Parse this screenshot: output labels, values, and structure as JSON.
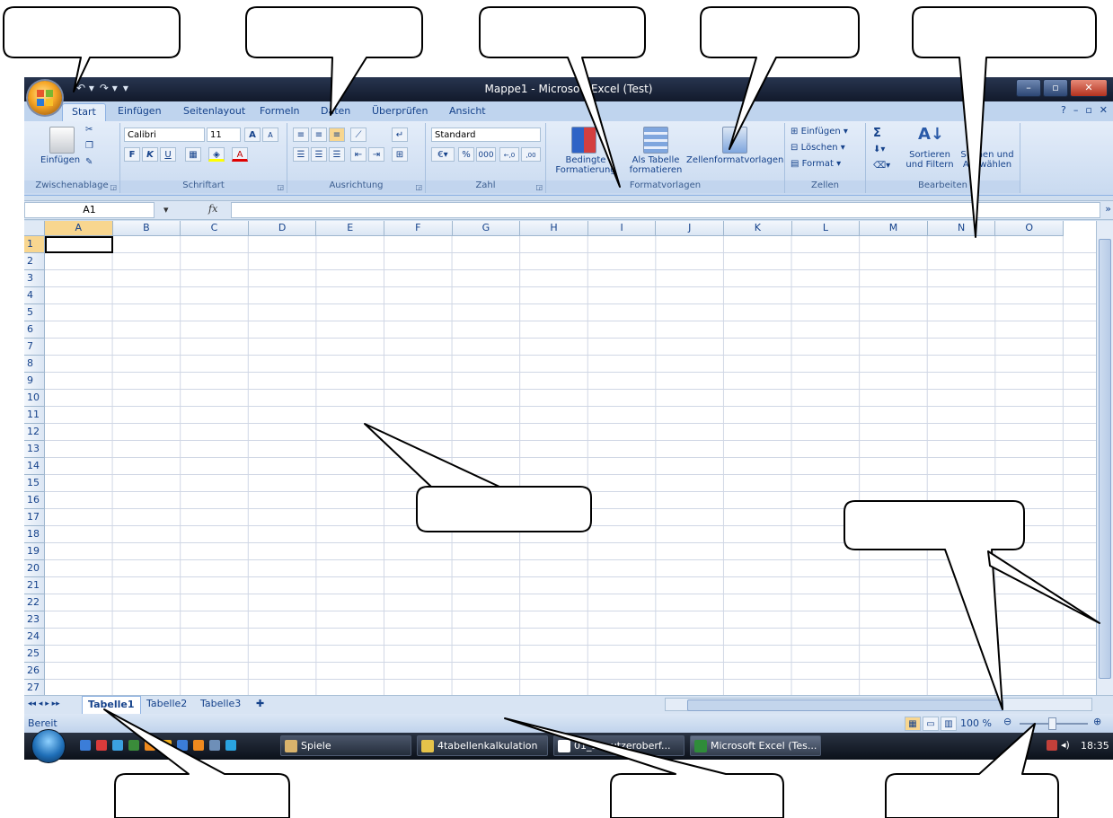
{
  "window": {
    "title": "Mappe1 - Microsoft Excel (Test)",
    "qat": [
      "↶ ▾",
      "↷ ▾",
      "▾"
    ]
  },
  "tabs": [
    "Start",
    "Einfügen",
    "Seitenlayout",
    "Formeln",
    "Daten",
    "Überprüfen",
    "Ansicht"
  ],
  "ribbon": {
    "clipboard": {
      "paste": "Einfügen",
      "label": "Zwischenablage"
    },
    "font": {
      "name": "Calibri",
      "size": "11",
      "bold": "F",
      "italic": "K",
      "underline": "U",
      "grow": "A",
      "shrink": "A",
      "label": "Schriftart"
    },
    "alignment": {
      "label": "Ausrichtung"
    },
    "number": {
      "format": "Standard",
      "percent": "%",
      "thousands": "000",
      "inc_decimal": "←,0",
      "dec_decimal": ",00",
      "label": "Zahl"
    },
    "styles": {
      "conditional": "Bedingte Formatierung",
      "as_table": "Als Tabelle formatieren",
      "cell_styles": "Zellenformatvorlagen",
      "label": "Formatvorlagen"
    },
    "cells": {
      "insert": "Einfügen",
      "delete": "Löschen",
      "format": "Format",
      "label": "Zellen"
    },
    "editing": {
      "sum": "Σ",
      "sort": "Sortieren und Filtern",
      "find": "Suchen und Auswählen",
      "label": "Bearbeiten"
    }
  },
  "formula_bar": {
    "name_box": "A1",
    "fx": "fx",
    "value": ""
  },
  "columns": [
    "A",
    "B",
    "C",
    "D",
    "E",
    "F",
    "G",
    "H",
    "I",
    "J",
    "K",
    "L",
    "M",
    "N",
    "O"
  ],
  "rows": [
    "1",
    "2",
    "3",
    "4",
    "5",
    "6",
    "7",
    "8",
    "9",
    "10",
    "11",
    "12",
    "13",
    "14",
    "15",
    "16",
    "17",
    "18",
    "19",
    "20",
    "21",
    "22",
    "23",
    "24",
    "25",
    "26",
    "27"
  ],
  "sheets": [
    "Tabelle1",
    "Tabelle2",
    "Tabelle3"
  ],
  "status": {
    "text": "Bereit",
    "zoom": "100 %"
  },
  "taskbar": {
    "items": [
      "Spiele",
      "4tabellenkalkulation",
      "01_Benutzeroberf...",
      "Microsoft Excel (Tes..."
    ],
    "clock": "18:35"
  },
  "colors": {
    "ribbon": "#dbe6f4",
    "titlebar": "#1d2638",
    "accent": "#f8d68f"
  }
}
